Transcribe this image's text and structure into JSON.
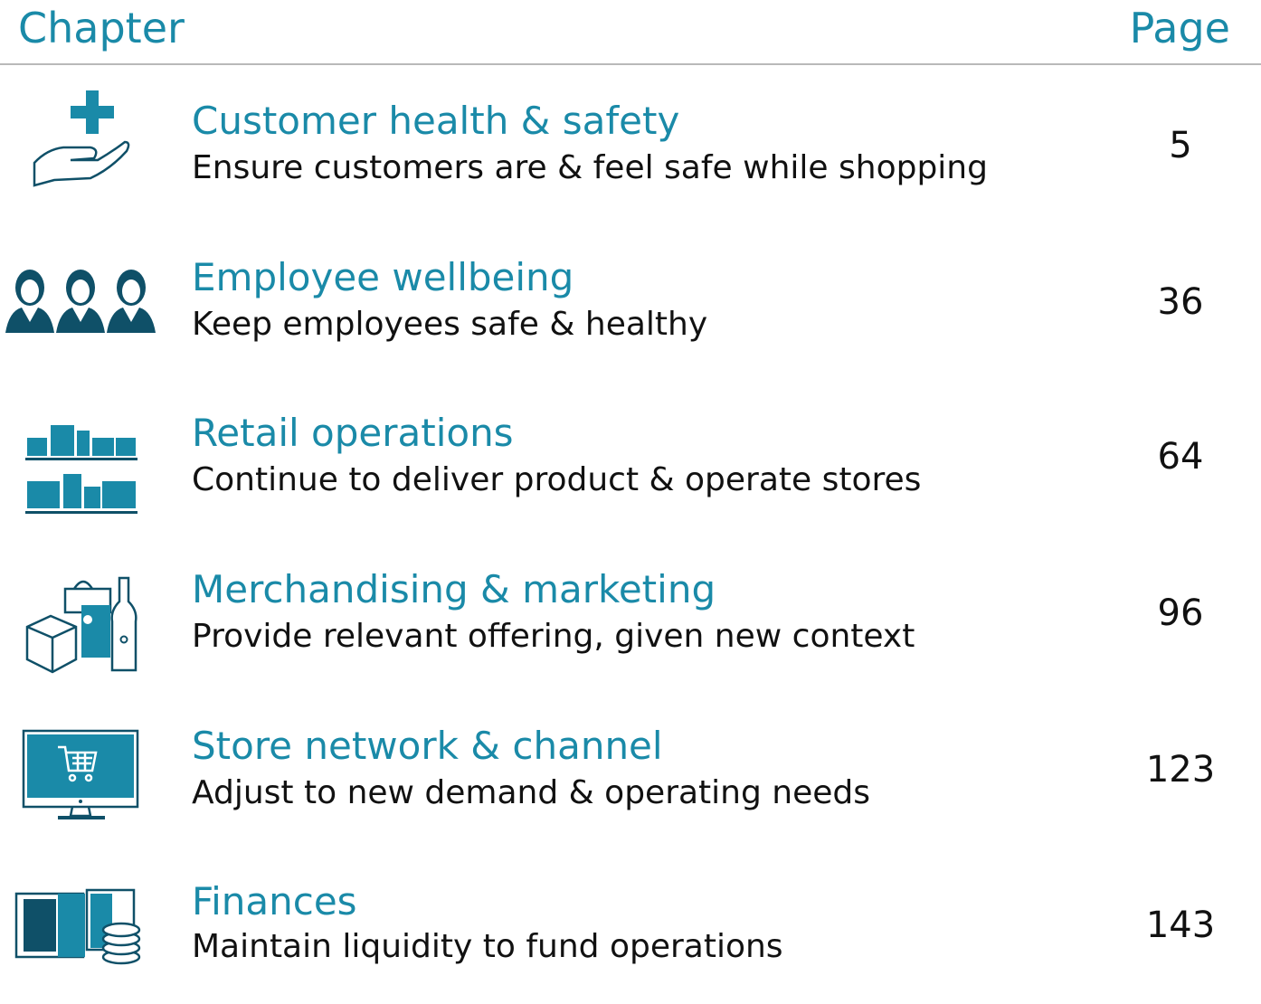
{
  "header": {
    "chapter_label": "Chapter",
    "page_label": "Page"
  },
  "rows": [
    {
      "icon": "hand-medical-cross-icon",
      "title": "Customer health & safety",
      "subtitle": "Ensure customers are & feel safe while shopping",
      "page": "5"
    },
    {
      "icon": "employees-icon",
      "title": "Employee wellbeing",
      "subtitle": "Keep employees safe & healthy",
      "page": "36"
    },
    {
      "icon": "shelf-boxes-icon",
      "title": "Retail operations",
      "subtitle": "Continue to deliver product & operate stores",
      "page": "64"
    },
    {
      "icon": "products-bag-bottle-icon",
      "title": "Merchandising & marketing",
      "subtitle": "Provide relevant offering, given new context",
      "page": "96"
    },
    {
      "icon": "monitor-cart-icon",
      "title": "Store network & channel",
      "subtitle": "Adjust to new demand & operating needs",
      "page": "123"
    },
    {
      "icon": "money-coins-icon",
      "title": "Finances",
      "subtitle": "Maintain liquidity to fund operations",
      "page": "143"
    }
  ],
  "colors": {
    "accent": "#1a8aa8",
    "icon_dark": "#0f5068",
    "rule": "#b9b9b9",
    "text": "#111111"
  }
}
